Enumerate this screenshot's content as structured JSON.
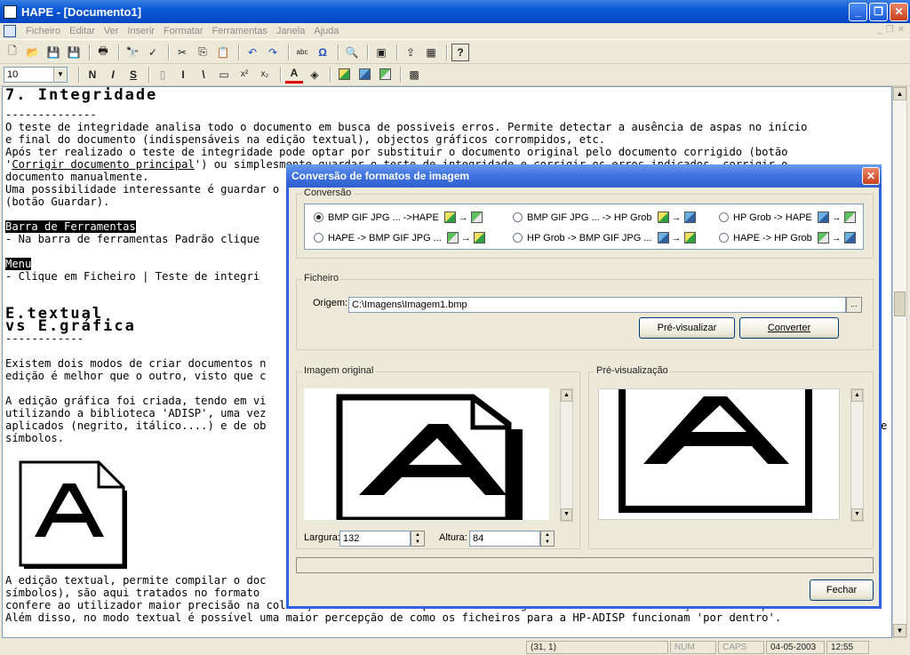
{
  "window": {
    "title": "HAPE - [Documento1]"
  },
  "menu": [
    "Ficheiro",
    "Editar",
    "Ver",
    "Inserir",
    "Formatar",
    "Ferramentas",
    "Janela",
    "Ajuda"
  ],
  "toolbar": {
    "font_size": "10",
    "format_buttons": [
      "N",
      "I",
      "S"
    ]
  },
  "document": {
    "heading1": "7. Integridade",
    "heading1_rule": "--------------",
    "p1_l1": "O teste de integridade analisa todo o documento em busca de possiveis erros. Permite detectar a ausência de aspas no início",
    "p1_l2": "e final do documento (indispensáveis na edição textual), objectos gráficos corrompidos, etc.",
    "p1_l3": "Após ter realizado o teste de integridade pode optar por substituir o documento original pelo documento corrigido (botão",
    "p1_l4_a": "'",
    "p1_l4_link": "Corrigir documento principal",
    "p1_l4_b": "') ou simplesmente guardar o teste de integridade e corrigir os erros indicados, corrigir o",
    "p1_l5": "documento manualmente.",
    "p1_l6": "Uma possibilidade interessante é guardar o teste de integridade",
    "p1_l7": "(botão Guardar).",
    "toolbar_heading": "Barra de Ferramentas",
    "toolbar_text": "- Na barra de ferramentas Padrão clique",
    "menu_heading": "Menu",
    "menu_text": "- Clique em Ficheiro | Teste de integri",
    "heading2a": "E.textual",
    "heading2b": "vs E.gráfica",
    "heading2_rule": "------------",
    "p2_l1": "Existem dois modos de criar documentos n",
    "p2_l2": "edição é melhor que o outro, visto que c",
    "p3_l1": "A edição gráfica foi criada, tendo em vi",
    "p3_l2": "utilizando a biblioteca 'ADISP', uma vez",
    "p3_l3": "aplicados (negrito, itálico....) e de ob",
    "p3_l3_end": "e",
    "p3_l4": "símbolos.",
    "p4_l1": "A edição textual, permite compilar o doc",
    "p4_l2": "símbolos), são aqui tratados no formato",
    "p4_l3": "confere ao utilizador maior precisão na colocação dos vários componentes ao longo do documento e formatação mais completa.",
    "p4_l4": "Além disso, no modo textual é possível uma maior percepção de como os ficheiros para a HP-ADISP funcionam 'por dentro'."
  },
  "status": {
    "position": "(31, 1)",
    "num": "NUM",
    "caps": "CAPS",
    "date": "04-05-2003",
    "time": "12:55"
  },
  "dialog": {
    "title": "Conversão de formatos de imagem",
    "conversion_group": "Conversão",
    "options": [
      {
        "label": "BMP GIF JPG ... ->HAPE",
        "selected": true
      },
      {
        "label": "BMP GIF JPG ... -> HP Grob",
        "selected": false
      },
      {
        "label": "HP Grob -> HAPE",
        "selected": false
      },
      {
        "label": "HAPE -> BMP GIF JPG ...",
        "selected": false
      },
      {
        "label": "HP Grob -> BMP GIF JPG ...",
        "selected": false
      },
      {
        "label": "HAPE -> HP Grob",
        "selected": false
      }
    ],
    "arrow": "→",
    "file_group": "Ficheiro",
    "origin_label": "Origem:",
    "origin_value": "C:\\Imagens\\Imagem1.bmp",
    "browse_label": "...",
    "preview_button": "Pré-visualizar",
    "convert_button": "Converter",
    "original_group": "Imagem original",
    "preview_group": "Pré-visualização",
    "width_label": "Largura:",
    "width_value": "132",
    "height_label": "Altura:",
    "height_value": "84",
    "close_button": "Fechar"
  }
}
